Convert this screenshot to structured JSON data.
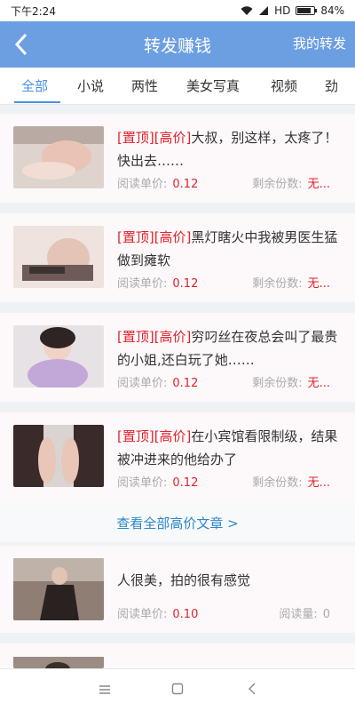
{
  "status_bar": {
    "time": "下午2:24",
    "signal": "HD",
    "battery": "84%",
    "battery_level": 0.84
  },
  "header": {
    "back_icon": "chevron-left-icon",
    "title": "转发赚钱",
    "my_forward": "我的转发"
  },
  "tabs": [
    "全部",
    "小说",
    "两性",
    "美女写真",
    "视频",
    "劲"
  ],
  "articles": [
    {
      "tag": "[置顶][高价]",
      "text": "大叔，别这样，太疼了！快出去……",
      "price_label": "阅读单价:",
      "price": "0.12",
      "remain_label": "剩余份数:",
      "remain": "无..."
    },
    {
      "tag": "[置顶][高价]",
      "text": "黑灯瞎火中我被男医生猛做到瘫软",
      "price_label": "阅读单价:",
      "price": "0.12",
      "remain_label": "剩余份数:",
      "remain": "无..."
    },
    {
      "tag": "[置顶][高价]",
      "text": "穷叼丝在夜总会叫了最贵的小姐,还白玩了她……",
      "price_label": "阅读单价:",
      "price": "0.12",
      "remain_label": "剩余份数:",
      "remain": "无..."
    },
    {
      "tag": "[置顶][高价]",
      "text": "在小宾馆看限制级，结果被冲进来的他给办了",
      "price_label": "阅读单价:",
      "price": "0.12",
      "remain_label": "剩余份数:",
      "remain": "无..."
    }
  ],
  "view_all": "查看全部高价文章 >",
  "normal_article": {
    "text": "人很美，拍的很有感觉",
    "price_label": "阅读单价:",
    "price": "0.10",
    "reads_label": "阅读量:",
    "reads": "0"
  },
  "nav": {
    "menu_icon": "menu-icon",
    "home_icon": "home-square-icon",
    "back_icon": "back-triangle-icon"
  }
}
